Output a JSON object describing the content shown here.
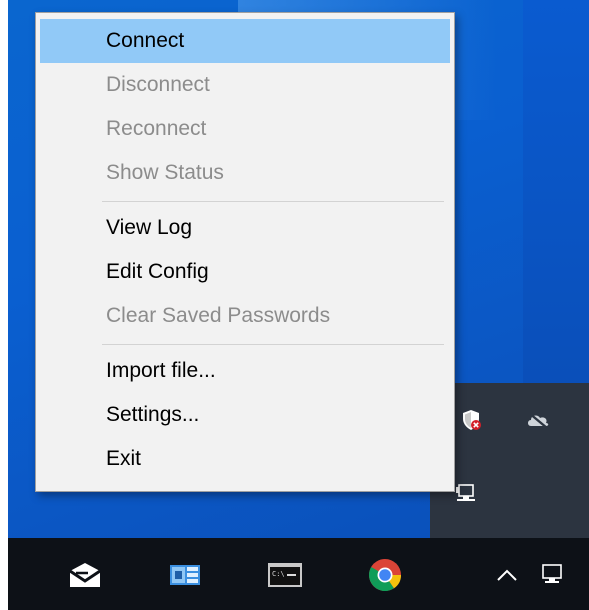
{
  "menu": {
    "items": [
      {
        "label": "Connect",
        "enabled": true,
        "highlighted": true
      },
      {
        "label": "Disconnect",
        "enabled": false
      },
      {
        "label": "Reconnect",
        "enabled": false
      },
      {
        "label": "Show Status",
        "enabled": false
      },
      {
        "label": "View Log",
        "enabled": true
      },
      {
        "label": "Edit Config",
        "enabled": true
      },
      {
        "label": "Clear Saved Passwords",
        "enabled": false
      },
      {
        "label": "Import file...",
        "enabled": true
      },
      {
        "label": "Settings...",
        "enabled": true
      },
      {
        "label": "Exit",
        "enabled": true
      }
    ]
  },
  "tray_flyout": {
    "icons": [
      "shield-alert-icon",
      "cloud-offline-icon",
      "network-monitor-icon"
    ]
  },
  "taskbar": {
    "buttons": [
      "mail-icon",
      "control-panel-icon",
      "command-prompt-icon",
      "chrome-icon"
    ],
    "tray": [
      "chevron-up-icon",
      "network-icon"
    ]
  },
  "colors": {
    "desktop": "#0a5fd0",
    "menu_bg": "#f2f2f2",
    "menu_highlight": "#91c9f7",
    "disabled_text": "#8c8c8c",
    "taskbar": "#0d1117"
  }
}
